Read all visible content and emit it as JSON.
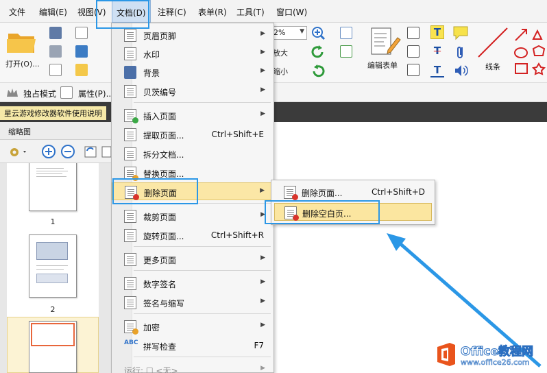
{
  "menubar": {
    "items": [
      "文件",
      "编辑(E)",
      "视图(V)",
      "文档(D)",
      "注释(C)",
      "表单(R)",
      "工具(T)",
      "窗口(W)"
    ],
    "active_index": 3
  },
  "ribbon": {
    "open_label": "打开(O)...",
    "zoom_value": "2%",
    "enlarge_label": "放大",
    "shrink_label": "缩小",
    "edit_form_label": "编辑表单",
    "lines_label": "线条"
  },
  "toolbar2": {
    "exclusive_mode": "独占模式",
    "properties": "属性(P)..."
  },
  "document_tab": {
    "title": "星云游戏修改器软件使用说明"
  },
  "thumbnails_panel": {
    "title": "缩略图",
    "pages": [
      "1",
      "2"
    ]
  },
  "document_menu": {
    "items": [
      {
        "label": "页眉页脚",
        "icon": "header-footer-icon",
        "submenu": true
      },
      {
        "label": "水印",
        "icon": "watermark-icon",
        "submenu": true
      },
      {
        "label": "背景",
        "icon": "background-icon",
        "submenu": true
      },
      {
        "label": "贝茨编号",
        "icon": "bates-number-icon",
        "submenu": true
      },
      {
        "label": "插入页面",
        "icon": "insert-page-icon",
        "submenu": true
      },
      {
        "label": "提取页面...",
        "icon": "extract-page-icon",
        "shortcut": "Ctrl+Shift+E"
      },
      {
        "label": "拆分文档...",
        "icon": "split-document-icon"
      },
      {
        "label": "替换页面...",
        "icon": "replace-page-icon"
      },
      {
        "label": "删除页面",
        "icon": "delete-page-icon",
        "submenu": true,
        "highlighted": true
      },
      {
        "label": "裁剪页面",
        "icon": "crop-page-icon",
        "submenu": true
      },
      {
        "label": "旋转页面...",
        "icon": "rotate-page-icon",
        "shortcut": "Ctrl+Shift+R"
      },
      {
        "label": "更多页面",
        "icon": "more-pages-icon",
        "submenu": true
      },
      {
        "label": "数字签名",
        "icon": "digital-signature-icon",
        "submenu": true
      },
      {
        "label": "签名与缩写",
        "icon": "sign-initials-icon",
        "submenu": true
      },
      {
        "label": "加密",
        "icon": "encrypt-icon",
        "submenu": true
      },
      {
        "label": "拼写检查",
        "icon": "spell-check-icon",
        "shortcut": "F7"
      },
      {
        "label": "运行: ☐ <无>",
        "icon": "run-action-icon",
        "submenu": true,
        "disabled": true
      }
    ]
  },
  "delete_submenu": {
    "items": [
      {
        "label": "删除页面...",
        "shortcut": "Ctrl+Shift+D",
        "icon": "delete-page-icon"
      },
      {
        "label": "删除空白页...",
        "icon": "delete-blank-page-icon",
        "highlighted": true
      }
    ]
  },
  "watermark": {
    "brand": "Office教程网",
    "url": "www.office26.com"
  },
  "colors": {
    "callout": "#2b97e6",
    "highlight": "#fbe7a6",
    "office_orange": "#e9541c"
  }
}
